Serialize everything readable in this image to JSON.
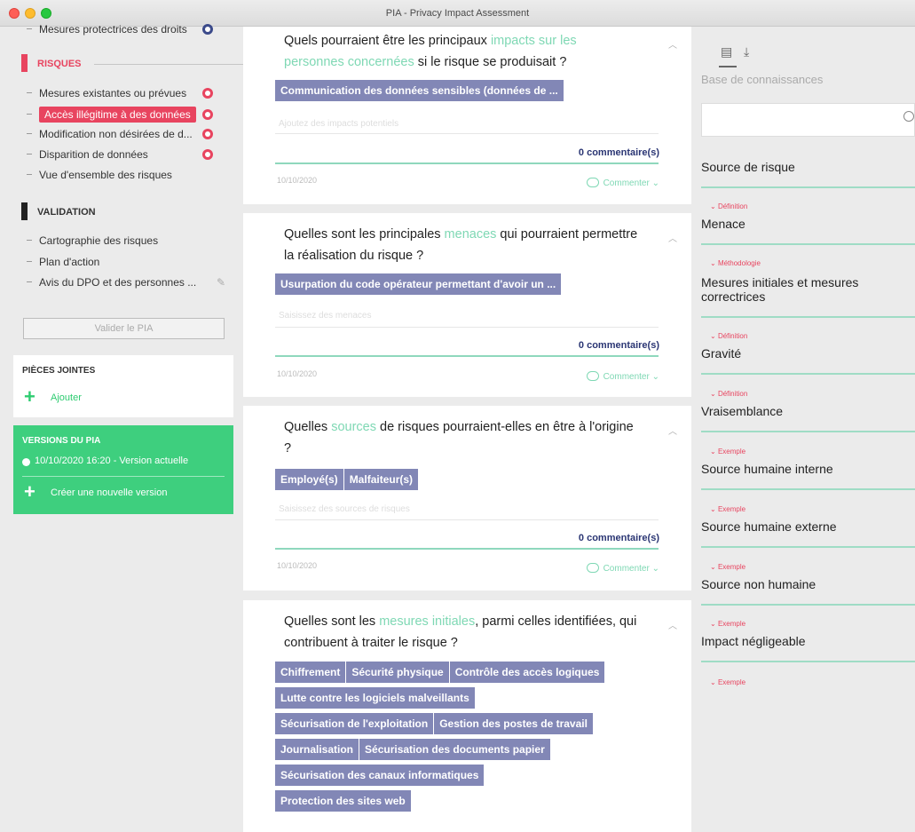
{
  "window": {
    "title": "PIA - Privacy Impact Assessment"
  },
  "sidebar": {
    "top_item": "Mesures protectrices des droits",
    "risques_header": "RISQUES",
    "risques_items": [
      "Mesures existantes ou prévues",
      "Accès illégitime à des données",
      "Modification non désirées de d...",
      "Disparition de données",
      "Vue d'ensemble des risques"
    ],
    "validation_header": "VALIDATION",
    "validation_items": [
      "Cartographie des risques",
      "Plan d'action",
      "Avis du DPO et des personnes ..."
    ],
    "validate_button": "Valider le PIA",
    "attachments": {
      "title": "PIÈCES JOINTES",
      "add": "Ajouter"
    },
    "versions": {
      "title": "VERSIONS DU PIA",
      "current": "10/10/2020 16:20 - Version actuelle",
      "new": "Créer une nouvelle version"
    }
  },
  "colors": {
    "accent_green": "#3ecf7e",
    "accent_red": "#e8445f",
    "tag_purple": "#8287b6",
    "highlight": "#7fd8b4"
  },
  "cards": [
    {
      "q_pre": "Quels pourraient être les principaux ",
      "q_hl": "impacts sur les personnes concernées",
      "q_post": " si le risque se produisait ?",
      "tags": [
        "Communication des données sensibles (données de ..."
      ],
      "placeholder": "Ajoutez des impacts potentiels",
      "comments": "0 commentaire(s)",
      "date": "10/10/2020",
      "comment_link": "Commenter"
    },
    {
      "q_pre": "Quelles sont les principales ",
      "q_hl": "menaces",
      "q_post": " qui pourraient permettre la réalisation du risque ?",
      "tags": [
        "Usurpation du code opérateur permettant d'avoir un ..."
      ],
      "placeholder": "Saisissez des menaces",
      "comments": "0 commentaire(s)",
      "date": "10/10/2020",
      "comment_link": "Commenter"
    },
    {
      "q_pre": "Quelles ",
      "q_hl": "sources",
      "q_post": " de risques pourraient-elles en être à l'origine ?",
      "tags": [
        "Employé(s)",
        "Malfaiteur(s)"
      ],
      "placeholder": "Saisissez des sources de risques",
      "comments": "0 commentaire(s)",
      "date": "10/10/2020",
      "comment_link": "Commenter"
    },
    {
      "q_pre": "Quelles sont les ",
      "q_hl": "mesures initiales",
      "q_post": ", parmi celles identifiées, qui contribuent à traiter le risque ?",
      "tags": [
        "Chiffrement",
        "Sécurité physique",
        "Contrôle des accès logiques",
        "Lutte contre les logiciels malveillants",
        "Sécurisation de l'exploitation",
        "Gestion des postes de travail",
        "Journalisation",
        "Sécurisation des documents papier",
        "Sécurisation des canaux informatiques",
        "Protection des sites web"
      ]
    }
  ],
  "knowledge": {
    "title": "Base de connaissances",
    "items": [
      {
        "category": "",
        "name": "Source de risque"
      },
      {
        "category": "Définition",
        "name": "Menace"
      },
      {
        "category": "Méthodologie",
        "name": "Mesures initiales et mesures correctrices"
      },
      {
        "category": "Définition",
        "name": "Gravité"
      },
      {
        "category": "Définition",
        "name": "Vraisemblance"
      },
      {
        "category": "Exemple",
        "name": "Source humaine interne"
      },
      {
        "category": "Exemple",
        "name": "Source humaine externe"
      },
      {
        "category": "Exemple",
        "name": "Source non humaine"
      },
      {
        "category": "Exemple",
        "name": "Impact négligeable"
      },
      {
        "category": "Exemple",
        "name": ""
      }
    ]
  }
}
